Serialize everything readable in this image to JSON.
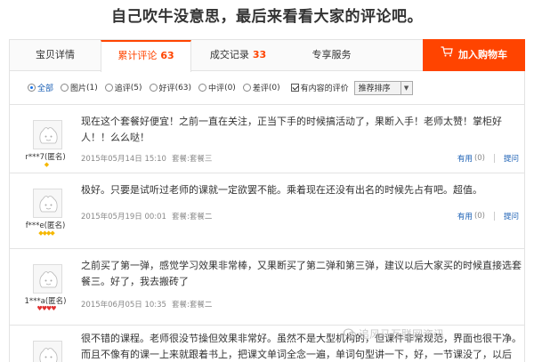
{
  "headline": "自己吹牛没意思，最后来看看大家的评论吧。",
  "tabs": [
    {
      "label": "宝贝详情",
      "count": ""
    },
    {
      "label": "累计评论",
      "count": "63"
    },
    {
      "label": "成交记录",
      "count": "33"
    },
    {
      "label": "专享服务",
      "count": ""
    }
  ],
  "cart_button": {
    "label": "加入购物车",
    "icon": "cart-icon"
  },
  "filters": [
    {
      "label": "全部",
      "count": "",
      "selected": true
    },
    {
      "label": "图片",
      "count": "(1)",
      "selected": false
    },
    {
      "label": "追评",
      "count": "(5)",
      "selected": false
    },
    {
      "label": "好评",
      "count": "(63)",
      "selected": false
    },
    {
      "label": "中评",
      "count": "(0)",
      "selected": false
    },
    {
      "label": "差评",
      "count": "(0)",
      "selected": false
    }
  ],
  "has_content_checkbox": {
    "label": "有内容的评价",
    "checked": true
  },
  "sort_select": {
    "value": "推荐排序"
  },
  "reviews": [
    {
      "user": "r***7(匿名)",
      "badge_color": "yellow",
      "badge_count": 1,
      "text": "现在这个套餐好便宜！之前一直在关注，正当下手的时候搞活动了，果断入手！老师太赞！掌柜好人！！么么哒！",
      "date": "2015年05月14日 15:10",
      "package": "套餐:套餐三",
      "useful_label": "有用",
      "useful_count": "(0)",
      "ask_label": "提问"
    },
    {
      "user": "f***e(匿名)",
      "badge_color": "yellow",
      "badge_count": 4,
      "text": "极好。只要是试听过老师的课就一定欲罢不能。乘着现在还没有出名的时候先占有吧。超值。",
      "date": "2015年05月19日 00:01",
      "package": "套餐:套餐二",
      "useful_label": "有用",
      "useful_count": "(0)",
      "ask_label": "提问"
    },
    {
      "user": "1***a(匿名)",
      "badge_color": "red",
      "badge_count": 4,
      "text": "之前买了第一弹，感觉学习效果非常棒，又果断买了第二弹和第三弹，建议以后大家买的时候直接选套餐三。好了，我去搬砖了",
      "date": "2015年06月05日 10:35",
      "package": "套餐:套餐二",
      "useful_label": "有用",
      "useful_count": "(0)",
      "ask_label": "提问"
    },
    {
      "user": "",
      "text": "很不错的课程。老师很没节操但效果非常好。虽然不是大型机构的，但课件非常规范，界面也很干净。而且不像有的课一上来就跟着书上，把课文单词全念一遍，单词句型讲一下，好，一节课没了，以后"
    }
  ],
  "watermark": "追风马互联网资讯"
}
